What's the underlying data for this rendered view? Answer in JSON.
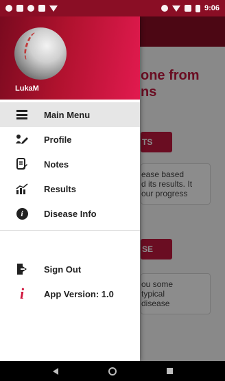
{
  "status_bar": {
    "time": "9:06",
    "left_icons": [
      "settings-icon",
      "mail-icon",
      "record-icon",
      "sd-card-icon",
      "play-store-icon"
    ],
    "right_icons": [
      "dnd-icon",
      "wifi-icon",
      "signal-icon",
      "battery-icon"
    ]
  },
  "background": {
    "heading_line1": "one from",
    "heading_line2": "ns",
    "button1_label": "TS",
    "card1_lines": [
      "ease based",
      "d its results. It",
      "our progress"
    ],
    "button2_label": "SE",
    "card2_lines": [
      "ou some",
      "typical",
      "disease"
    ]
  },
  "drawer": {
    "username": "LukaM",
    "items": [
      {
        "label": "Main Menu",
        "icon": "list-icon",
        "active": true
      },
      {
        "label": "Profile",
        "icon": "edit-profile-icon"
      },
      {
        "label": "Notes",
        "icon": "notes-icon"
      },
      {
        "label": "Results",
        "icon": "chart-icon"
      },
      {
        "label": "Disease Info",
        "icon": "info-icon"
      }
    ],
    "secondary_items": [
      {
        "label": "Sign Out",
        "icon": "sign-out-icon"
      },
      {
        "label": "App Version: 1.0",
        "icon": "app-version-icon"
      }
    ]
  },
  "colors": {
    "primary": "#8a0e25",
    "accent": "#c2183f",
    "header_gradient_end": "#e21a4f"
  }
}
